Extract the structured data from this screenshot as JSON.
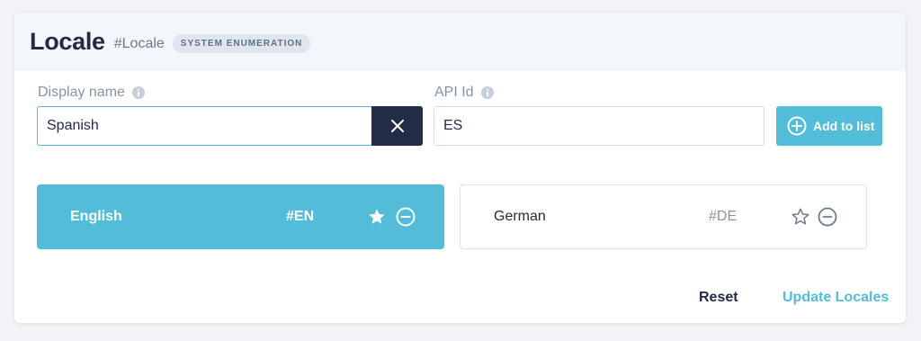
{
  "header": {
    "title": "Locale",
    "api_tag": "#Locale",
    "badge": "SYSTEM ENUMERATION"
  },
  "form": {
    "display_name_label": "Display name",
    "display_name_value": "Spanish",
    "api_id_label": "API Id",
    "api_id_value": "ES",
    "add_button_label": "Add to list"
  },
  "locales": [
    {
      "name": "English",
      "code": "#EN",
      "default": true
    },
    {
      "name": "German",
      "code": "#DE",
      "default": false
    }
  ],
  "footer": {
    "reset_label": "Reset",
    "update_label": "Update Locales"
  },
  "colors": {
    "accent": "#52bcd9",
    "dark": "#232c47",
    "header_bg": "#f3f7fc"
  }
}
